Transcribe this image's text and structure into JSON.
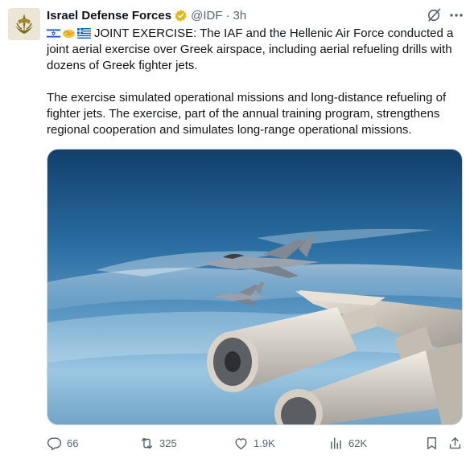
{
  "tweet": {
    "author_name": "Israel Defense Forces",
    "handle": "@IDF",
    "separator": "·",
    "time": "3h",
    "verified_badge": "gold-verified-icon",
    "flags": [
      "israel-flag",
      "handshake-emoji",
      "greece-flag"
    ],
    "paragraph1": "JOINT EXERCISE: The IAF and the Hellenic Air Force conducted a joint aerial exercise over Greek airspace, including aerial refueling drills with dozens of Greek fighter jets.",
    "paragraph2": "The exercise simulated operational missions and long-distance refueling of fighter jets. The exercise, part of the annual training program, strengthens regional cooperation and simulates long-range operational missions."
  },
  "actions": {
    "replies": "66",
    "reposts": "325",
    "likes": "1.9K",
    "views": "62K"
  },
  "colors": {
    "text_primary": "#0f1419",
    "text_secondary": "#536471",
    "verified_gold": "#e2b719",
    "sky_top": "#1a5c8f",
    "sky_bottom": "#a9cfe6"
  }
}
